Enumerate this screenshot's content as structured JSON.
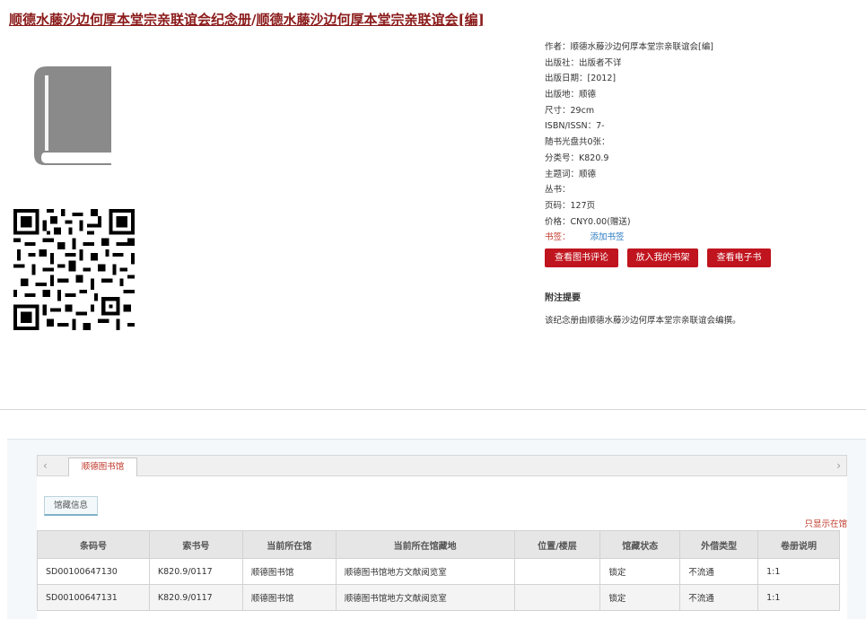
{
  "title": {
    "series": "顺德水藤沙边何厚本堂宗亲联谊会纪念册",
    "separator": "/",
    "responsibility": "顺德水藤沙边何厚本堂宗亲联谊会[编]"
  },
  "icons": {
    "book": "book-icon",
    "qr": "qr-code-icon",
    "prev": "chevron-left-icon",
    "next": "chevron-right-icon"
  },
  "metadata": [
    {
      "key": "作者：",
      "value": "顺德水藤沙边何厚本堂宗亲联谊会[编]"
    },
    {
      "key": "出版社：",
      "value": "出版者不详"
    },
    {
      "key": "出版日期：",
      "value": "[2012]"
    },
    {
      "key": "出版地：",
      "value": "顺德"
    },
    {
      "key": "尺寸：",
      "value": "29cm"
    },
    {
      "key": "ISBN/ISSN：",
      "value": "7-"
    },
    {
      "key": "随书光盘共0张：",
      "value": ""
    },
    {
      "key": "分类号：",
      "value": "K820.9"
    },
    {
      "key": "主题词：",
      "value": "顺德"
    },
    {
      "key": "丛书：",
      "value": ""
    },
    {
      "key": "页码：",
      "value": "127页"
    },
    {
      "key": "价格：",
      "value": "CNY0.00(赠送)"
    }
  ],
  "bookmark": {
    "label": "书签：",
    "link": "添加书签"
  },
  "buttons": {
    "review": "查看图书评论",
    "shelf": "放入我的书架",
    "ebook": "查看电子书"
  },
  "note": {
    "heading": "附注提要",
    "text": "该纪念册由顺德水藤沙边何厚本堂宗亲联谊会编撰。"
  },
  "holdings": {
    "library_tab": "顺德图书馆",
    "subtab": "馆藏信息",
    "only_this": "只显示在馆",
    "columns": [
      "条码号",
      "索书号",
      "当前所在馆",
      "当前所在馆藏地",
      "位置/楼层",
      "馆藏状态",
      "外借类型",
      "卷册说明"
    ],
    "rows": [
      [
        "SD00100647130",
        "K820.9/0117",
        "顺德图书馆",
        "顺德图书馆地方文献阅览室",
        "",
        "锁定",
        "不流通",
        "1:1"
      ],
      [
        "SD00100647131",
        "K820.9/0117",
        "顺德图书馆",
        "顺德图书馆地方文献阅览室",
        "",
        "锁定",
        "不流通",
        "1:1"
      ]
    ]
  },
  "colors": {
    "brand_red": "#c0141e",
    "title_red": "#8b1a1a",
    "link_blue": "#2a7ac0"
  }
}
